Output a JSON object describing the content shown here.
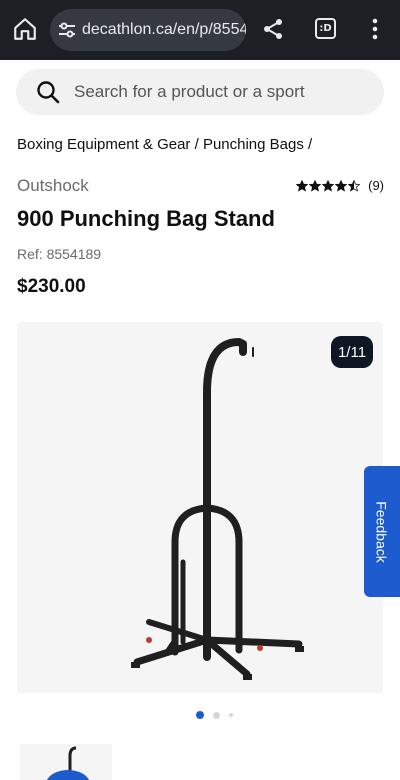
{
  "browser": {
    "url": "decathlon.ca/en/p/8554",
    "tabs_label": ":D",
    "icons": [
      "home-icon",
      "tune-icon",
      "share-icon",
      "tabs-icon",
      "more-vert-icon"
    ]
  },
  "search": {
    "placeholder": "Search for a product or a sport"
  },
  "breadcrumb": {
    "items": [
      "Boxing Equipment & Gear /",
      "Punching Bags /"
    ]
  },
  "product": {
    "brand": "Outshock",
    "rating_value": 4.5,
    "rating_count": "(9)",
    "title": "900 Punching Bag Stand",
    "ref": "Ref: 8554189",
    "price": "$230.00"
  },
  "gallery": {
    "counter": "1/11",
    "active_dot": 0
  },
  "feedback_label": "Feedback",
  "colors": {
    "accent": "#1c5cce",
    "chrome_bg": "#1c1f24",
    "counter_bg": "#0f1624"
  }
}
